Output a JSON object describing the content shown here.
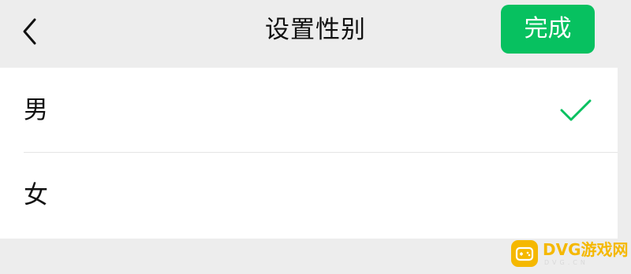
{
  "header": {
    "back_icon": "chevron-left-icon",
    "title": "设置性别",
    "done_label": "完成"
  },
  "options": [
    {
      "label": "男",
      "selected": true
    },
    {
      "label": "女",
      "selected": false
    }
  ],
  "selected_icon": "checkmark-icon",
  "watermark": {
    "text": "DVG游戏网",
    "subtext": "DVG.CN"
  },
  "colors": {
    "background": "#ededed",
    "accent": "#07c160",
    "list_background": "#ffffff",
    "watermark": "#f5b800"
  }
}
